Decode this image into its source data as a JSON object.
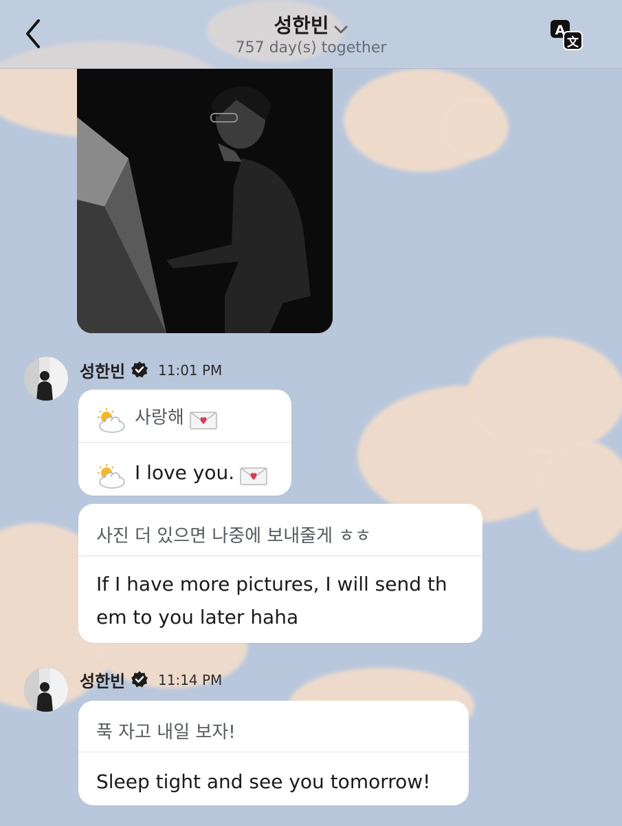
{
  "header": {
    "title": "성한빈",
    "subtitle": "757 day(s) together"
  },
  "messages": [
    {
      "sender": "성한빈",
      "time": "11:01 PM",
      "bubbles": [
        {
          "ko": "사랑해",
          "en": "I love you."
        },
        {
          "ko": "사진 더 있으면 나중에 보내줄게 ㅎㅎ",
          "en_line1": "If I have more pictures, I will send th",
          "en_line2": "em to you later haha"
        }
      ]
    },
    {
      "sender": "성한빈",
      "time": "11:14 PM",
      "bubbles": [
        {
          "ko": "푹 자고 내일 보자!",
          "en": "Sleep tight and see you tomorrow!"
        }
      ]
    }
  ],
  "colors": {
    "background": "#b9c7dc",
    "cloud": "#f0dccb",
    "bubble": "#ffffff"
  },
  "icons": {
    "back": "chevron-left-icon",
    "translate": "translate-icon",
    "dropdown": "chevron-down-icon",
    "verified": "verified-badge-icon",
    "weather": "sun-behind-cloud-icon",
    "letter": "love-letter-icon"
  }
}
